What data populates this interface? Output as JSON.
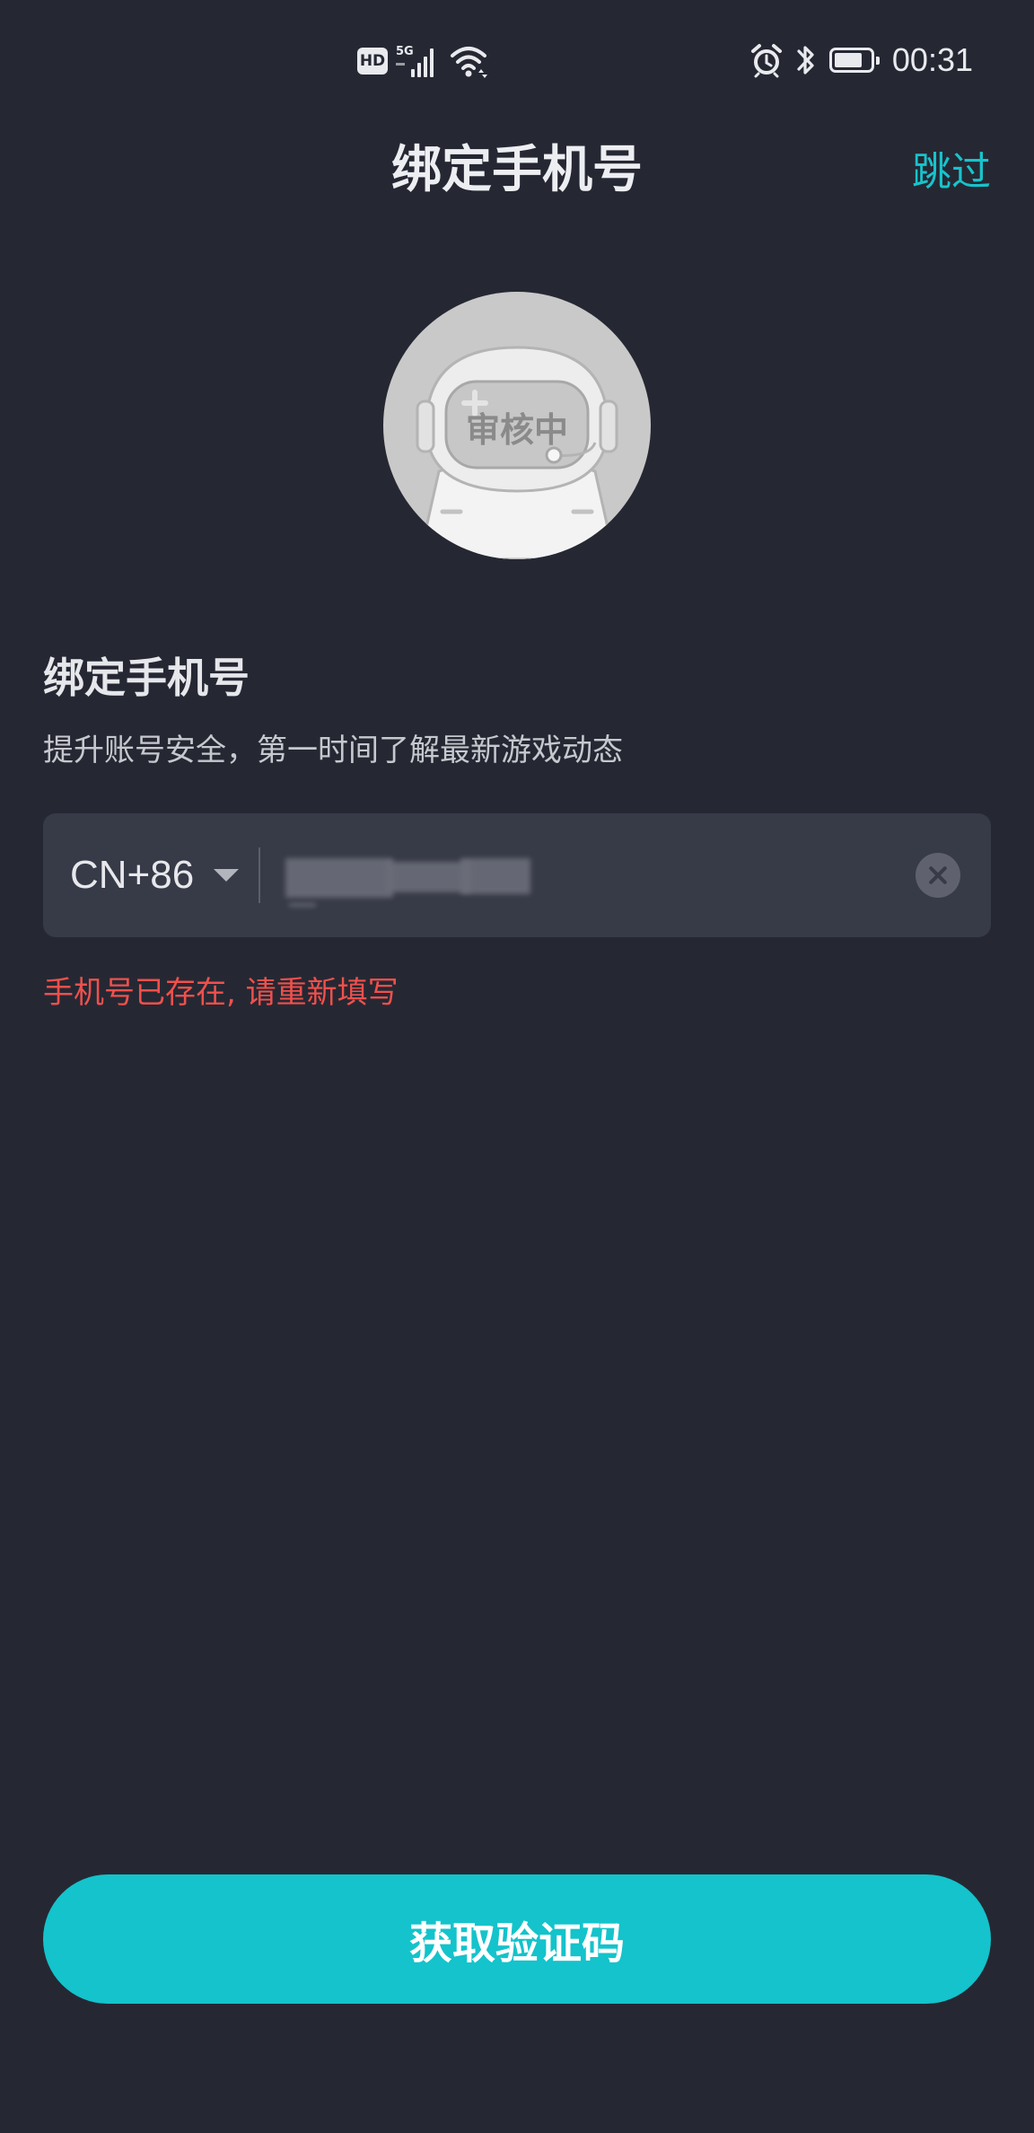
{
  "status_bar": {
    "hd_badge": "HD",
    "network_label": "5G",
    "time": "00:31",
    "icons": [
      "hd-icon",
      "signal-icon",
      "wifi-icon",
      "alarm-icon",
      "bluetooth-icon",
      "battery-icon"
    ],
    "battery_level": 0.8
  },
  "header": {
    "title": "绑定手机号",
    "skip_label": "跳过"
  },
  "avatar": {
    "status_label": "审核中"
  },
  "section": {
    "heading": "绑定手机号",
    "description": "提升账号安全，第一时间了解最新游戏动态"
  },
  "phone_field": {
    "country_code": "CN+86",
    "value": "",
    "clear_icon": "clear-icon"
  },
  "error": {
    "message": "手机号已存在, 请重新填写"
  },
  "actions": {
    "get_code_label": "获取验证码"
  },
  "colors": {
    "background": "#252833",
    "accent": "#14c3cb",
    "input_background": "#373a47",
    "error": "#f0504c"
  }
}
